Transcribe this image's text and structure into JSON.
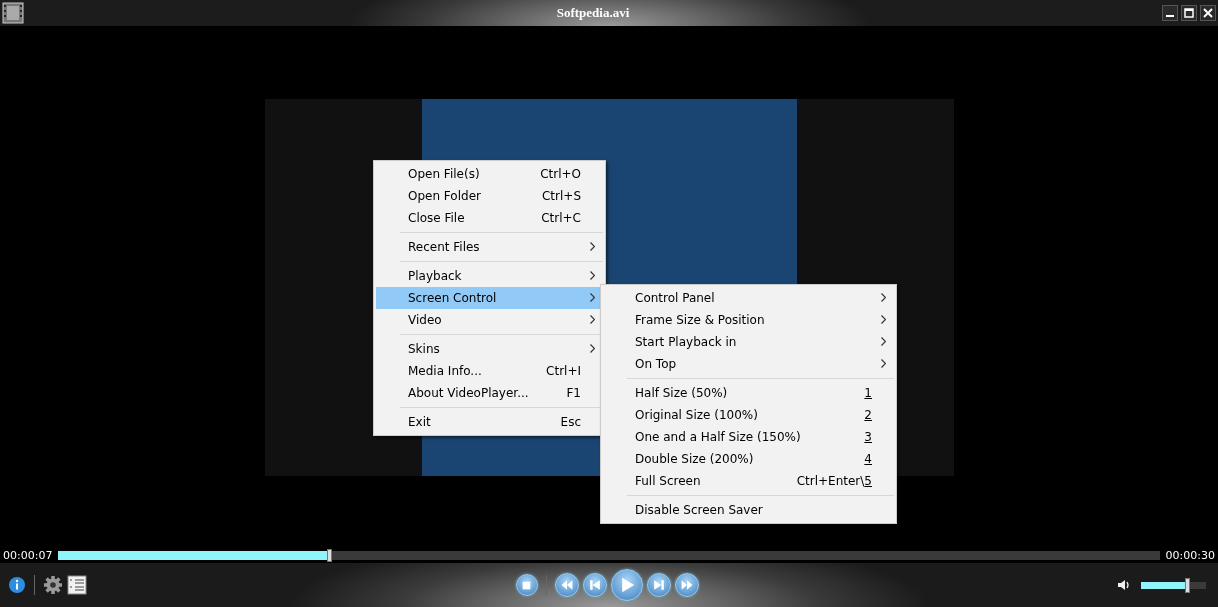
{
  "window": {
    "title": "Softpedia.avi"
  },
  "context_menu": {
    "shortcut_last_char_underlined": false,
    "groups": [
      [
        {
          "label": "Open File(s)",
          "shortcut": "Ctrl+O",
          "submenu": false,
          "selected": false
        },
        {
          "label": "Open Folder",
          "shortcut": "Ctrl+S",
          "submenu": false,
          "selected": false
        },
        {
          "label": "Close File",
          "shortcut": "Ctrl+C",
          "submenu": false,
          "selected": false
        }
      ],
      [
        {
          "label": "Recent Files",
          "submenu": true,
          "selected": false
        }
      ],
      [
        {
          "label": "Playback",
          "submenu": true,
          "selected": false
        },
        {
          "label": "Screen Control",
          "submenu": true,
          "selected": true
        },
        {
          "label": "Video",
          "submenu": true,
          "selected": false
        }
      ],
      [
        {
          "label": "Skins",
          "submenu": true,
          "selected": false
        },
        {
          "label": "Media Info...",
          "shortcut": "Ctrl+I",
          "submenu": false,
          "selected": false
        },
        {
          "label": "About VideoPlayer...",
          "shortcut": "F1",
          "submenu": false,
          "selected": false
        }
      ],
      [
        {
          "label": "Exit",
          "shortcut": "Esc",
          "submenu": false,
          "selected": false
        }
      ]
    ]
  },
  "submenu": {
    "shortcut_last_char_underlined": true,
    "groups": [
      [
        {
          "label": "Control Panel",
          "submenu": true,
          "selected": false
        },
        {
          "label": "Frame Size & Position",
          "submenu": true,
          "selected": false
        },
        {
          "label": "Start Playback in",
          "submenu": true,
          "selected": false
        },
        {
          "label": "On Top",
          "submenu": true,
          "selected": false
        }
      ],
      [
        {
          "label": "Half Size (50%)",
          "shortcut": "1",
          "submenu": false,
          "selected": false
        },
        {
          "label": "Original Size (100%)",
          "shortcut": "2",
          "submenu": false,
          "selected": false
        },
        {
          "label": "One and a Half Size (150%)",
          "shortcut": "3",
          "submenu": false,
          "selected": false
        },
        {
          "label": "Double Size (200%)",
          "shortcut": "4",
          "submenu": false,
          "selected": false
        },
        {
          "label": "Full Screen",
          "shortcut": "Ctrl+Enter\\5",
          "submenu": false,
          "selected": false
        }
      ],
      [
        {
          "label": "Disable Screen Saver",
          "submenu": false,
          "selected": false
        }
      ]
    ]
  },
  "seek": {
    "elapsed": "00:00:07",
    "duration": "00:00:30",
    "level": 0.246
  },
  "volume": {
    "level": 0.7
  }
}
